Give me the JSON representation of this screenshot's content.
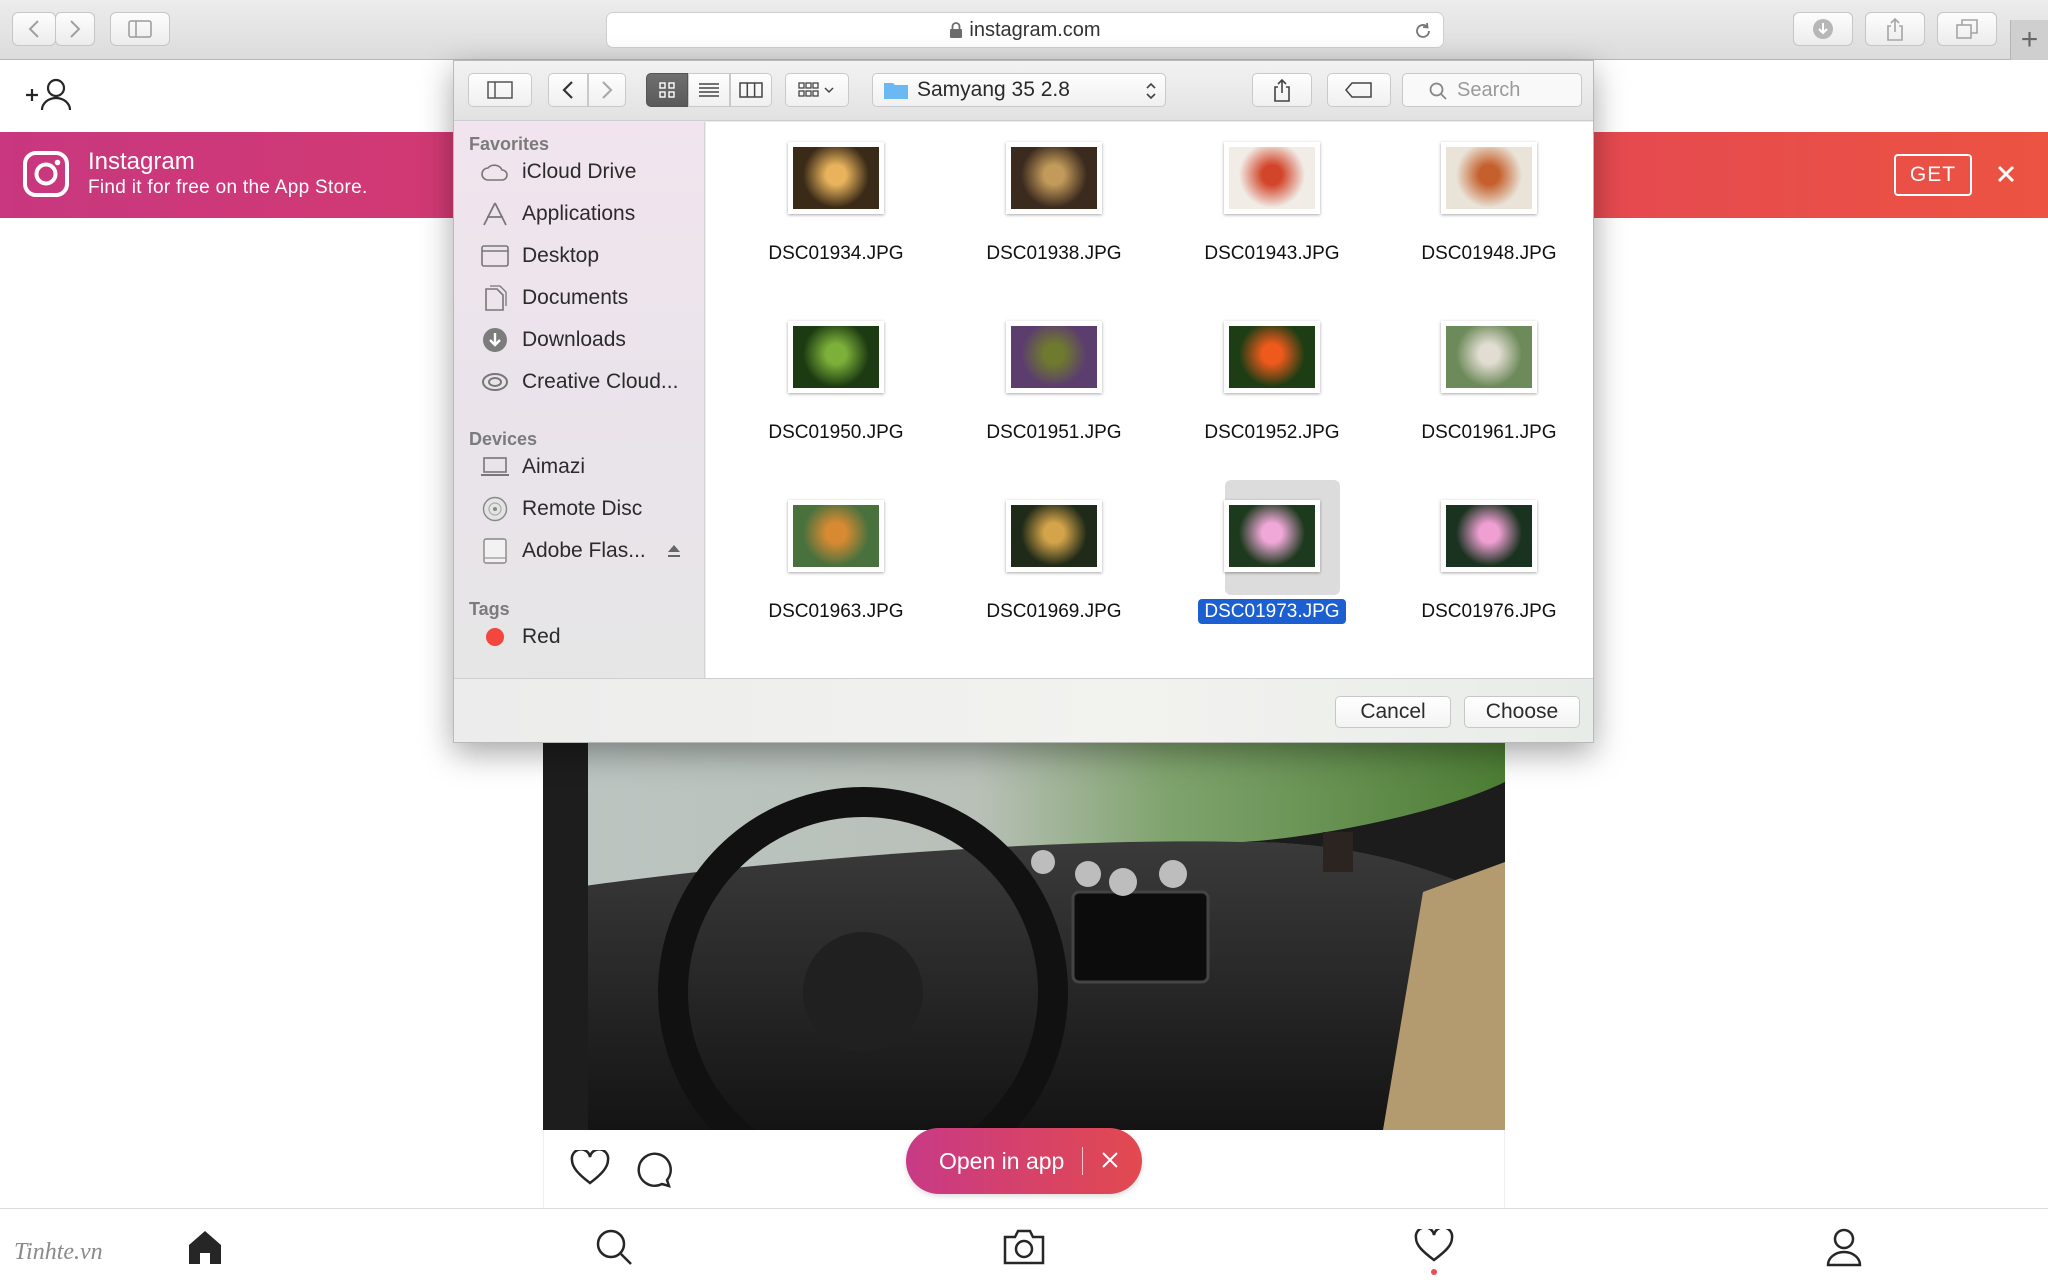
{
  "browser": {
    "url": "instagram.com"
  },
  "banner": {
    "app_name": "Instagram",
    "subtitle": "Find it for free on the App Store.",
    "get_label": "GET"
  },
  "open_in_app": {
    "label": "Open in app"
  },
  "watermark": "Tinhte.vn",
  "dialog": {
    "location": "Samyang 35 2.8",
    "search_placeholder": "Search",
    "sidebar": {
      "favorites_header": "Favorites",
      "favorites": [
        {
          "label": "iCloud Drive",
          "icon": "cloud-icon"
        },
        {
          "label": "Applications",
          "icon": "applications-icon"
        },
        {
          "label": "Desktop",
          "icon": "desktop-icon"
        },
        {
          "label": "Documents",
          "icon": "documents-icon"
        },
        {
          "label": "Downloads",
          "icon": "downloads-icon"
        },
        {
          "label": "Creative Cloud...",
          "icon": "creative-cloud-icon"
        }
      ],
      "devices_header": "Devices",
      "devices": [
        {
          "label": "Aimazi",
          "icon": "laptop-icon"
        },
        {
          "label": "Remote Disc",
          "icon": "disc-icon"
        },
        {
          "label": "Adobe Flas...",
          "icon": "drive-icon"
        }
      ],
      "tags_header": "Tags",
      "tags": [
        {
          "label": "Red",
          "color": "#f2473f"
        }
      ]
    },
    "files": [
      {
        "name": "DSC01934.JPG",
        "colors": [
          "#3a2a18",
          "#e8b35c"
        ]
      },
      {
        "name": "DSC01938.JPG",
        "colors": [
          "#3b2a1e",
          "#c29a5a"
        ]
      },
      {
        "name": "DSC01943.JPG",
        "colors": [
          "#f1ece6",
          "#d2452a"
        ]
      },
      {
        "name": "DSC01948.JPG",
        "colors": [
          "#e9e3d8",
          "#c5602c"
        ]
      },
      {
        "name": "DSC01950.JPG",
        "colors": [
          "#1c3b12",
          "#7db03a"
        ]
      },
      {
        "name": "DSC01951.JPG",
        "colors": [
          "#5b3d6e",
          "#6f7a2e"
        ]
      },
      {
        "name": "DSC01952.JPG",
        "colors": [
          "#1d3d14",
          "#ee5a1c"
        ]
      },
      {
        "name": "DSC01961.JPG",
        "colors": [
          "#6d8a5a",
          "#e2ddd2"
        ]
      },
      {
        "name": "DSC01963.JPG",
        "colors": [
          "#49713e",
          "#d88a32"
        ]
      },
      {
        "name": "DSC01969.JPG",
        "colors": [
          "#1f2a18",
          "#d4a44a"
        ]
      },
      {
        "name": "DSC01973.JPG",
        "colors": [
          "#1e3a1e",
          "#f0a8d8"
        ],
        "selected": true
      },
      {
        "name": "DSC01976.JPG",
        "colors": [
          "#1a3320",
          "#ef9fd2"
        ]
      }
    ],
    "cancel_label": "Cancel",
    "choose_label": "Choose"
  },
  "colors": {
    "banner_start": "#c8377f",
    "banner_end": "#ec5341",
    "selection": "#1b5fd1",
    "notification_dot": "#ed4956"
  }
}
